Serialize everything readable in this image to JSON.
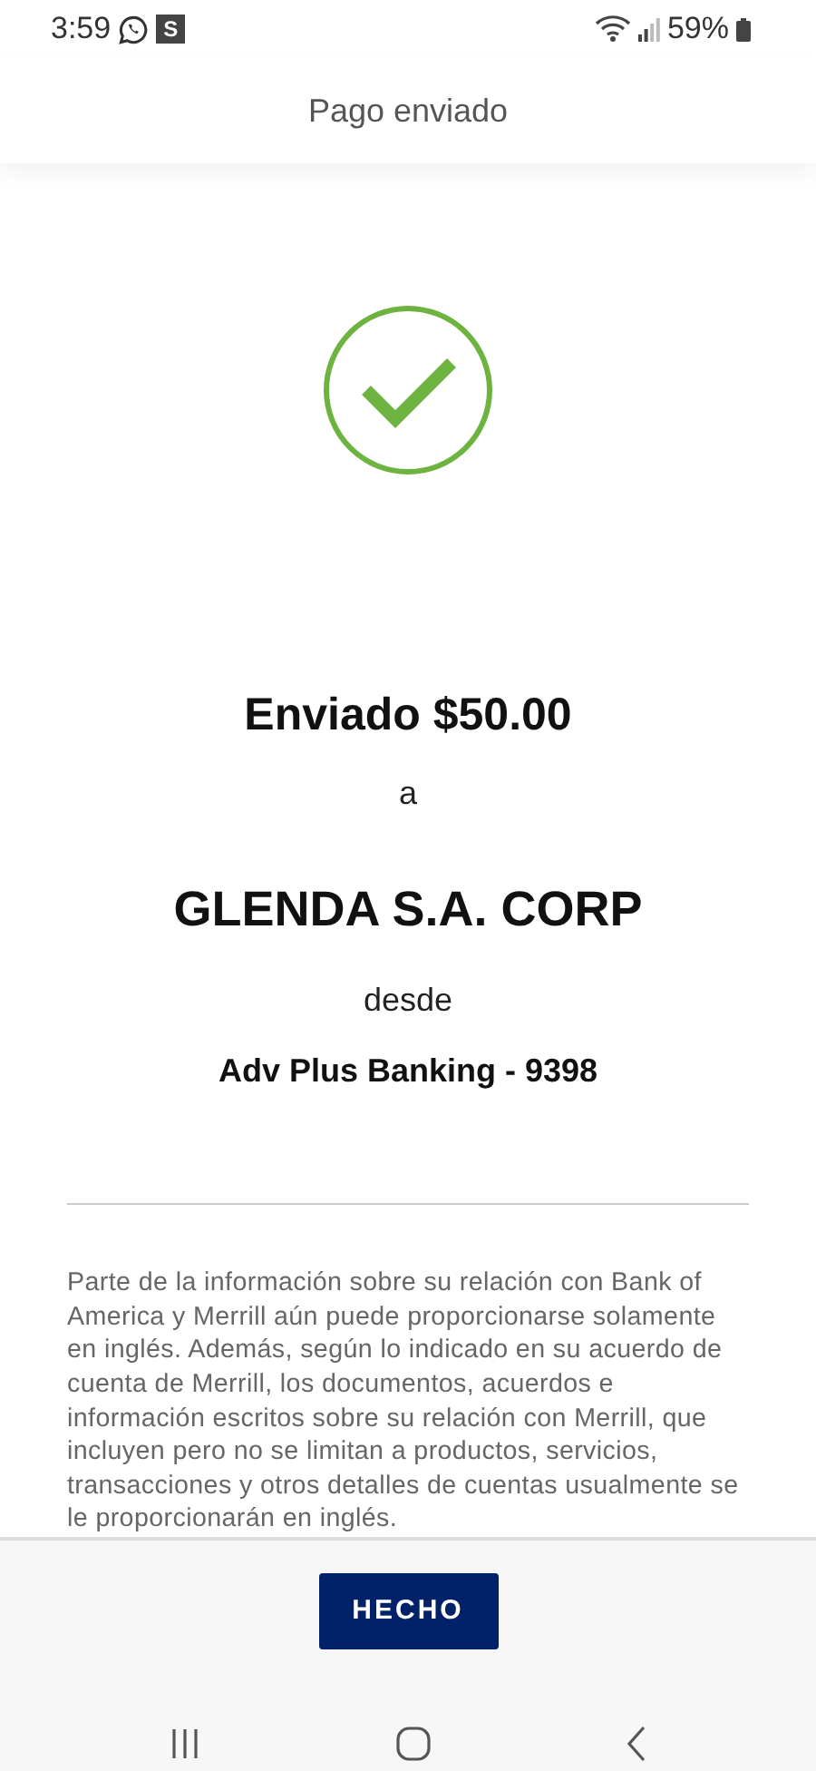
{
  "status_bar": {
    "time": "3:59",
    "app_badge": "S",
    "battery": "59%"
  },
  "header": {
    "title": "Pago enviado"
  },
  "confirmation": {
    "amount_line": "Enviado $50.00",
    "to_word": "a",
    "recipient": "GLENDA S.A. CORP",
    "from_word": "desde",
    "account": "Adv Plus Banking - 9398"
  },
  "disclaimer": "Parte de la información sobre su relación con Bank of America y Merrill aún puede proporcionarse solamente en inglés. Además, según lo indicado en su acuerdo de cuenta de Merrill, los documentos, acuerdos e información escritos sobre su relación con Merrill, que incluyen pero no se limitan a productos, servicios, transacciones y otros detalles de cuentas usualmente se le proporcionarán en inglés.",
  "footer": {
    "button": "HECHO"
  }
}
